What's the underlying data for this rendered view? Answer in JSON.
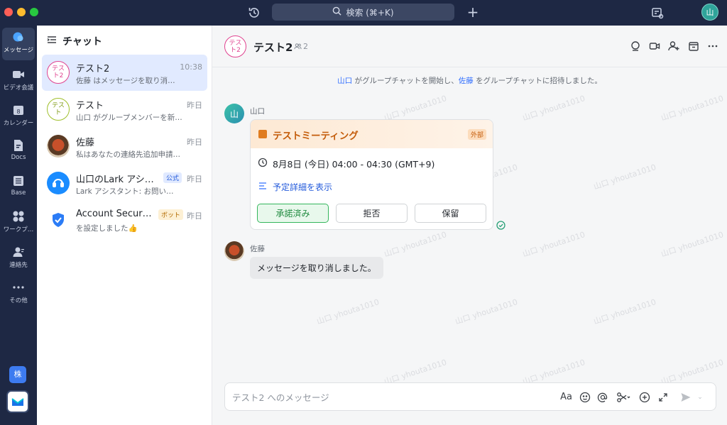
{
  "titlebar": {
    "search_label": "検索 (⌘+K)",
    "avatar_text": "山"
  },
  "rail": {
    "items": [
      {
        "label": "メッセージ",
        "icon": "message-icon"
      },
      {
        "label": "ビデオ会議",
        "icon": "video-icon"
      },
      {
        "label": "カレンダー",
        "icon": "calendar-icon"
      },
      {
        "label": "Docs",
        "icon": "docs-icon"
      },
      {
        "label": "Base",
        "icon": "base-icon"
      },
      {
        "label": "ワークプ…",
        "icon": "workplace-icon"
      },
      {
        "label": "連絡先",
        "icon": "contacts-icon"
      },
      {
        "label": "その他",
        "icon": "more-icon"
      }
    ],
    "corp_badge": "株"
  },
  "sidebar": {
    "title": "チャット",
    "chats": [
      {
        "title": "テスト2",
        "avatar": "テス\nト2",
        "time": "10:38",
        "preview": "佐藤 はメッセージを取り消…",
        "badge": ""
      },
      {
        "title": "テスト",
        "avatar": "テス\nト",
        "time": "昨日",
        "preview": "山口 がグループメンバーを新…",
        "badge": ""
      },
      {
        "title": "佐藤",
        "avatar": "",
        "time": "昨日",
        "preview": "私はあなたの連絡先追加申請…",
        "badge": ""
      },
      {
        "title": "山口のLark アシス…",
        "avatar": "",
        "time": "昨日",
        "preview": "Lark アシスタント: お問い…",
        "badge": "公式"
      },
      {
        "title": "Account Securi…",
        "avatar": "",
        "time": "昨日",
        "preview": "を設定しました👍",
        "badge": "ボット"
      }
    ]
  },
  "chat": {
    "title": "テスト2",
    "avatar": "テス\nト2",
    "member_count": "2",
    "system_message": {
      "actor": "山口",
      "part1": " がグループチャットを開始し、",
      "invitee": "佐藤",
      "part2": " をグループチャットに招待しました。"
    },
    "messages": [
      {
        "sender": "山口",
        "avatar_text": "山",
        "card": {
          "title": "テストミーティング",
          "tag": "外部",
          "time": "8月8日 (今日) 04:00 - 04:30 (GMT+9)",
          "details_link": "予定詳細を表示",
          "buttons": [
            "承諾済み",
            "拒否",
            "保留"
          ]
        }
      },
      {
        "sender": "佐藤",
        "text": "メッセージを取り消しました。"
      }
    ],
    "composer_placeholder": "テスト2 へのメッセージ",
    "watermark": "山口 yhouta1010"
  },
  "colors": {
    "accent": "#3370ff",
    "nav_bg": "#1e2844",
    "accepted_green": "#34b65c",
    "card_orange": "#c45c0a"
  }
}
